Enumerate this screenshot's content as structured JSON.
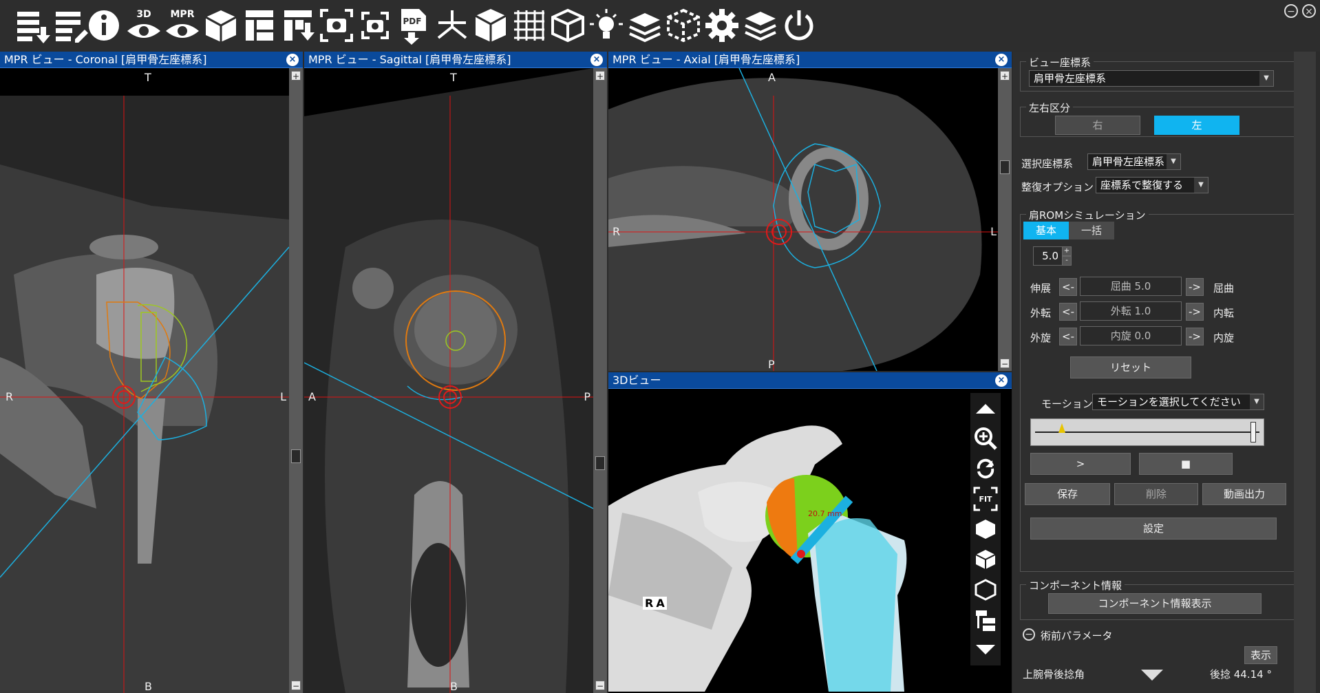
{
  "toolbar": {
    "icons": [
      "export-list-icon",
      "edit-list-icon",
      "info-icon",
      "3d-view-icon",
      "mpr-view-icon",
      "volume-cube-icon",
      "layout-icon",
      "layout-export-icon",
      "screenshot-icon",
      "multi-screenshot-icon",
      "pdf-export-icon",
      "axis-icon",
      "orientation-cube-icon",
      "grid-icon",
      "wireframe-cube-icon",
      "light-icon",
      "layers-3d-icon",
      "dashed-cube-icon",
      "settings-gear-icon",
      "stack-icon",
      "power-icon"
    ],
    "label_3d": "3D",
    "label_mpr": "MPR",
    "label_pdf": "PDF"
  },
  "views": {
    "coronal": {
      "title": "MPR ビュー - Coronal [肩甲骨左座標系]",
      "top": "T",
      "bottom": "B",
      "left": "R",
      "right": "L"
    },
    "sagittal": {
      "title": "MPR ビュー - Sagittal [肩甲骨左座標系]",
      "top": "T",
      "bottom": "B",
      "left": "A",
      "right": "P"
    },
    "axial": {
      "title": "MPR ビュー - Axial [肩甲骨左座標系]",
      "top": "A",
      "bottom": "P",
      "left": "R",
      "right": "L"
    },
    "view3d": {
      "title": "3Dビュー",
      "measure": "20.7 mm",
      "orient_r": "R",
      "orient_a": "A"
    }
  },
  "panel": {
    "view_coords": {
      "title": "ビュー座標系",
      "value": "肩甲骨左座標系"
    },
    "side": {
      "title": "左右区分",
      "right": "右",
      "left": "左",
      "selected": "左"
    },
    "select_coords": {
      "label": "選択座標系",
      "value": "肩甲骨左座標系"
    },
    "reduction": {
      "label": "整復オプション",
      "value": "座標系で整復する"
    },
    "rom": {
      "title": "肩ROMシミュレーション",
      "tabs": [
        "基本",
        "一括"
      ],
      "active_tab": "基本",
      "step": "5.0",
      "rows": [
        {
          "left": "伸展",
          "value": "屈曲 5.0",
          "right": "屈曲"
        },
        {
          "left": "外転",
          "value": "外転 1.0",
          "right": "内転"
        },
        {
          "left": "外旋",
          "value": "内旋 0.0",
          "right": "内旋"
        }
      ],
      "dec": "<-",
      "inc": "->",
      "reset": "リセット",
      "motion_label": "モーション",
      "motion_placeholder": "モーションを選択してください",
      "play": ">",
      "stop": "■",
      "slider_marker_pct": 0.12,
      "slider_end_pct": 0.98
    },
    "actions": {
      "save": "保存",
      "delete": "削除",
      "video": "動画出力",
      "settings": "設定"
    },
    "component": {
      "title": "コンポーネント情報",
      "button": "コンポーネント情報表示"
    },
    "preop": {
      "title": "術前パラメータ",
      "show": "表示",
      "row_label": "上腕骨後捻角",
      "row_value": "後捻 44.14 °"
    }
  }
}
